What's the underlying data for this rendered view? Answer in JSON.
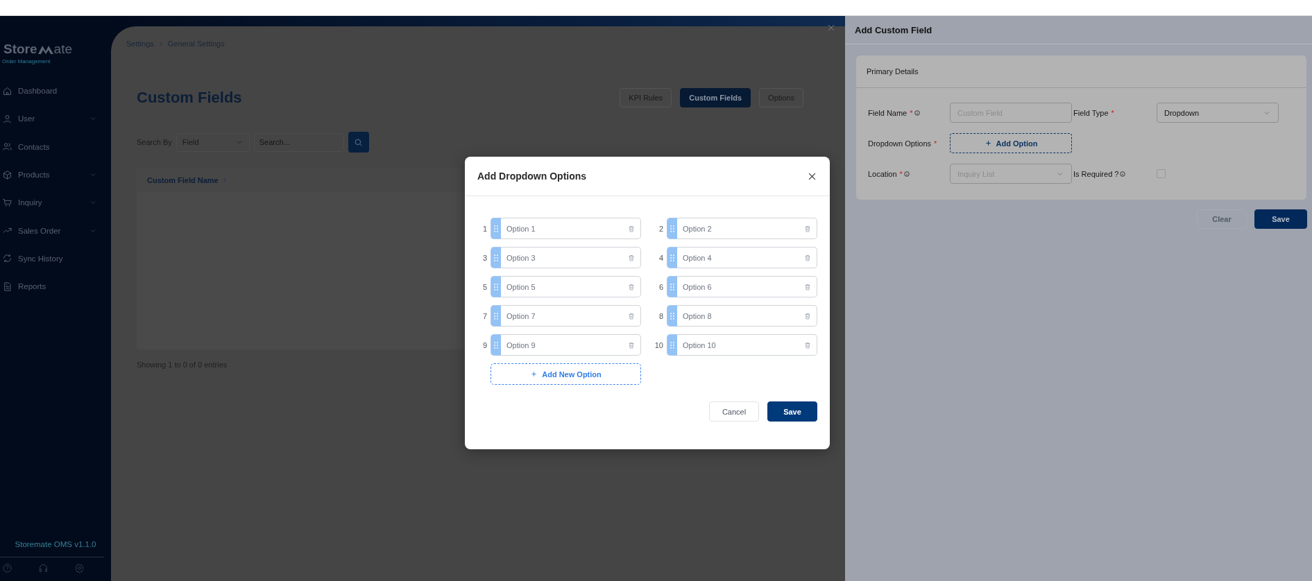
{
  "sidebar": {
    "logo_start": "Store",
    "logo_end": "ate",
    "subtitle": "Order Management",
    "items": [
      {
        "label": "Dashboard",
        "expandable": false
      },
      {
        "label": "User",
        "expandable": true
      },
      {
        "label": "Contacts",
        "expandable": false
      },
      {
        "label": "Products",
        "expandable": true
      },
      {
        "label": "Inquiry",
        "expandable": true
      },
      {
        "label": "Sales Order",
        "expandable": true
      },
      {
        "label": "Sync History",
        "expandable": false
      },
      {
        "label": "Reports",
        "expandable": false
      }
    ],
    "version": "Storemate OMS v1.1.0"
  },
  "page": {
    "breadcrumb": [
      "Settings",
      "General Settings"
    ],
    "title": "Custom Fields",
    "tabs": [
      {
        "label": "KPI Rules",
        "selected": false
      },
      {
        "label": "Custom Fields",
        "selected": true
      },
      {
        "label": "Options",
        "selected": false
      }
    ],
    "search": {
      "label": "Search By",
      "filter": "Field",
      "placeholder": "Search..."
    },
    "table": {
      "columns": [
        "Custom Field Name"
      ]
    },
    "footer": "Showing 1 to 0 of 0  entries"
  },
  "modal": {
    "title": "Add Dropdown Options",
    "options": [
      {
        "number": "1",
        "value": "Option 1"
      },
      {
        "number": "2",
        "value": "Option 2"
      },
      {
        "number": "3",
        "value": "Option 3"
      },
      {
        "number": "4",
        "value": "Option 4"
      },
      {
        "number": "5",
        "value": "Option 5"
      },
      {
        "number": "6",
        "value": "Option 6"
      },
      {
        "number": "7",
        "value": "Option 7"
      },
      {
        "number": "8",
        "value": "Option 8"
      },
      {
        "number": "9",
        "value": "Option 9"
      },
      {
        "number": "10",
        "value": "Option 10"
      }
    ],
    "add_button": "Add New Option",
    "buttons": [
      "Cancel",
      "Save"
    ]
  },
  "drawer": {
    "title": "Add Custom Field",
    "section": "Primary Details",
    "fields": [
      {
        "kind": "input",
        "label": "Field Name",
        "required_marker": "*",
        "info": true,
        "placeholder": "Custom Field"
      },
      {
        "kind": "select",
        "label": "Field Type",
        "required_marker": "*",
        "info": false,
        "value": "Dropdown"
      },
      {
        "kind": "add",
        "label": "Dropdown Options",
        "required_marker": "*",
        "info": false,
        "button": "Add Option"
      },
      {
        "kind": "select",
        "label": "Location",
        "required_marker": "*",
        "info": true,
        "placeholder": "Inquiry List"
      },
      {
        "kind": "checkbox",
        "label": "Is Required ?",
        "info": true,
        "checked": false
      }
    ],
    "buttons": [
      "Clear",
      "Save"
    ]
  }
}
